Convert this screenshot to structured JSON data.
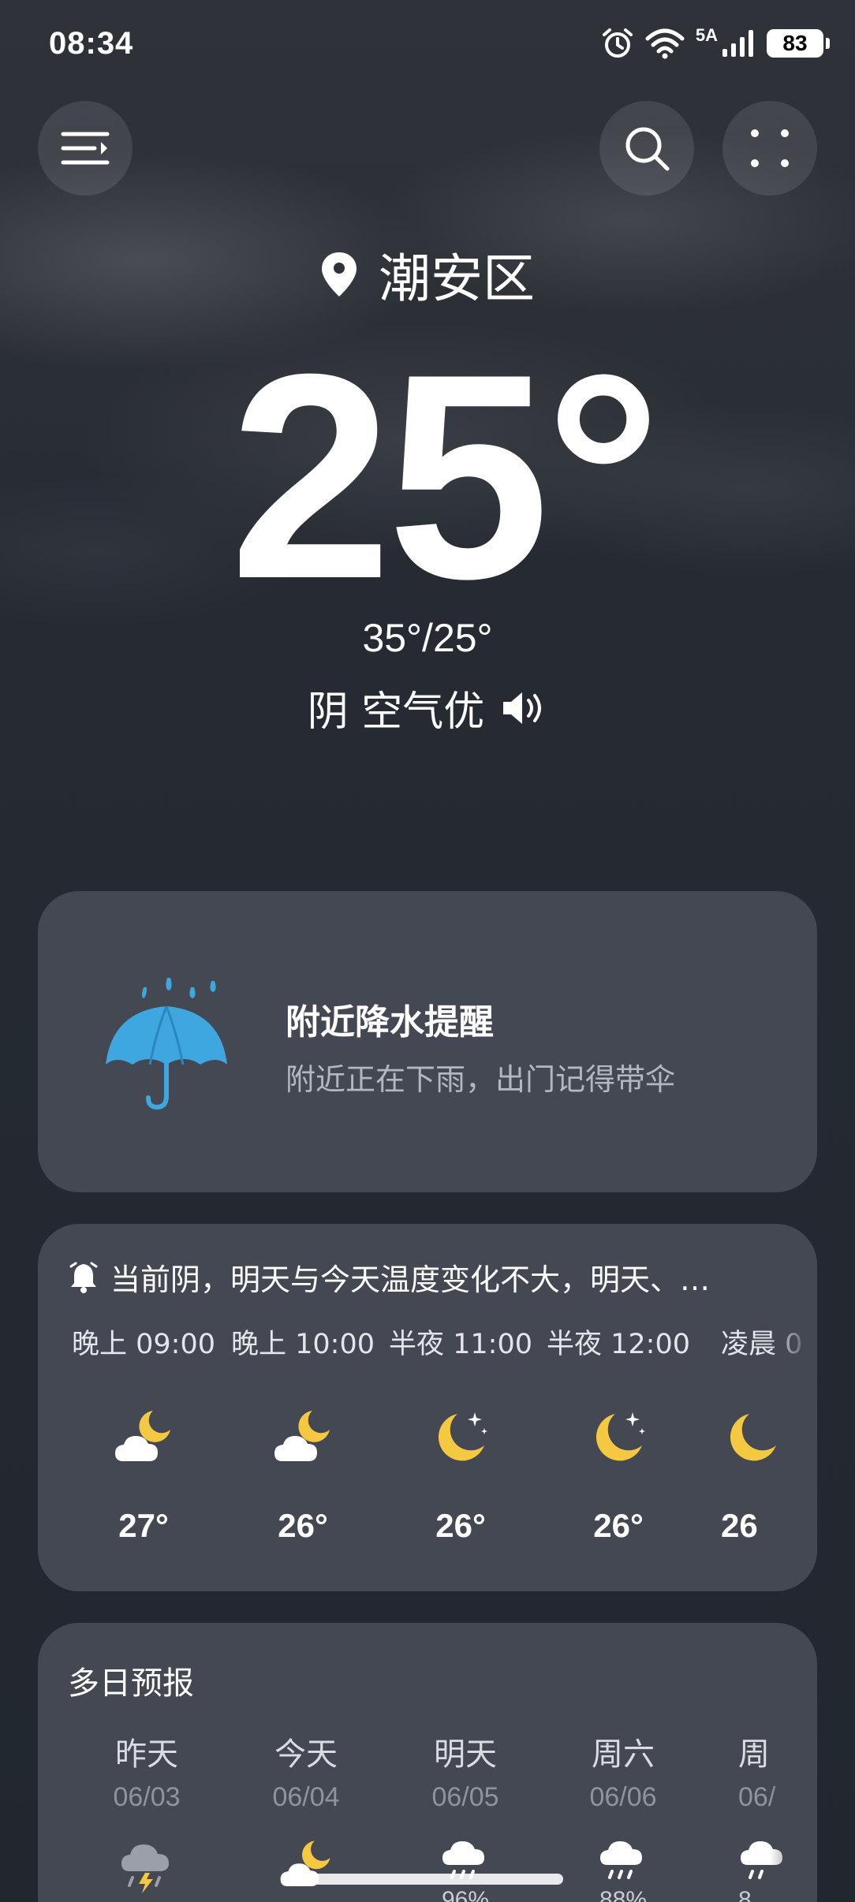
{
  "status_bar": {
    "time": "08:34",
    "signal_label": "5A",
    "battery": "83"
  },
  "header": {
    "location": "潮安区",
    "temperature": "25°",
    "high_low": "35°/25°",
    "condition": "阴 空气优"
  },
  "alert": {
    "title": "附近降水提醒",
    "subtitle": "附近正在下雨，出门记得带伞"
  },
  "hourly": {
    "summary": "当前阴，明天与今天温度变化不大，明天、…",
    "items": [
      {
        "time": "晚上 09:00",
        "icon": "moon-cloud-icon",
        "temp": "27°"
      },
      {
        "time": "晚上 10:00",
        "icon": "moon-cloud-icon",
        "temp": "26°"
      },
      {
        "time": "半夜 11:00",
        "icon": "moon-star-icon",
        "temp": "26°"
      },
      {
        "time": "半夜 12:00",
        "icon": "moon-star-icon",
        "temp": "26°"
      },
      {
        "time": "凌晨 0",
        "icon": "moon-icon",
        "temp": "26"
      }
    ]
  },
  "daily": {
    "title": "多日预报",
    "items": [
      {
        "name": "昨天",
        "date": "06/03",
        "icon": "thunderstorm-icon",
        "prob": ""
      },
      {
        "name": "今天",
        "date": "06/04",
        "icon": "moon-cloud-icon",
        "prob": ""
      },
      {
        "name": "明天",
        "date": "06/05",
        "icon": "rain-icon",
        "prob": "96%"
      },
      {
        "name": "周六",
        "date": "06/06",
        "icon": "rain-icon",
        "prob": "88%"
      },
      {
        "name": "周",
        "date": "06/",
        "icon": "rain-icon",
        "prob": "8"
      }
    ]
  },
  "colors": {
    "card": "#434852",
    "moon": "#f5c842",
    "umbrella": "#3fa7e0"
  }
}
